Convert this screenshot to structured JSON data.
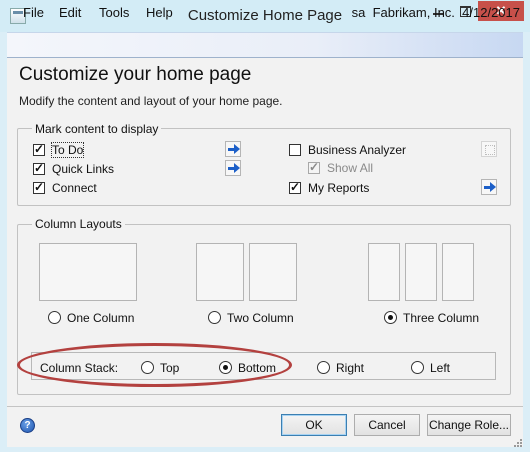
{
  "window": {
    "title": "Customize Home Page",
    "close_glyph": "✕"
  },
  "menu": {
    "items": [
      "File",
      "Edit",
      "Tools",
      "Help"
    ],
    "user": "sa",
    "company": "Fabrikam, Inc.",
    "date": "4/12/2017"
  },
  "header": {
    "title": "Customize your home page",
    "subtitle": "Modify the content and layout of your home page."
  },
  "content_group": {
    "legend": "Mark content to display",
    "left_items": [
      {
        "label": "To Do",
        "checked": true
      },
      {
        "label": "Quick Links",
        "checked": true
      },
      {
        "label": "Connect",
        "checked": true
      }
    ],
    "right_items": [
      {
        "label": "Business Analyzer",
        "checked": false
      },
      {
        "label": "Show All",
        "checked": true,
        "disabled": true
      },
      {
        "label": "My Reports",
        "checked": true
      }
    ],
    "icons": {
      "arrow": "right-arrow-icon",
      "expand": "expand-icon"
    }
  },
  "layouts_group": {
    "legend": "Column Layouts",
    "options": [
      {
        "label": "One Column",
        "selected": false
      },
      {
        "label": "Two Column",
        "selected": false
      },
      {
        "label": "Three Column",
        "selected": true
      }
    ]
  },
  "column_stack": {
    "label": "Column Stack:",
    "options": [
      {
        "label": "Top",
        "selected": false
      },
      {
        "label": "Bottom",
        "selected": true
      },
      {
        "label": "Right",
        "selected": false
      },
      {
        "label": "Left",
        "selected": false
      }
    ]
  },
  "footer": {
    "help_glyph": "?",
    "ok_label": "OK",
    "cancel_label": "Cancel",
    "change_role_label": "Change Role..."
  },
  "colors": {
    "titlebar": "#d3ecf6",
    "close_button": "#c7504a",
    "highlight_ellipse": "#b3413f",
    "arrow_blue": "#1c5fc8"
  }
}
